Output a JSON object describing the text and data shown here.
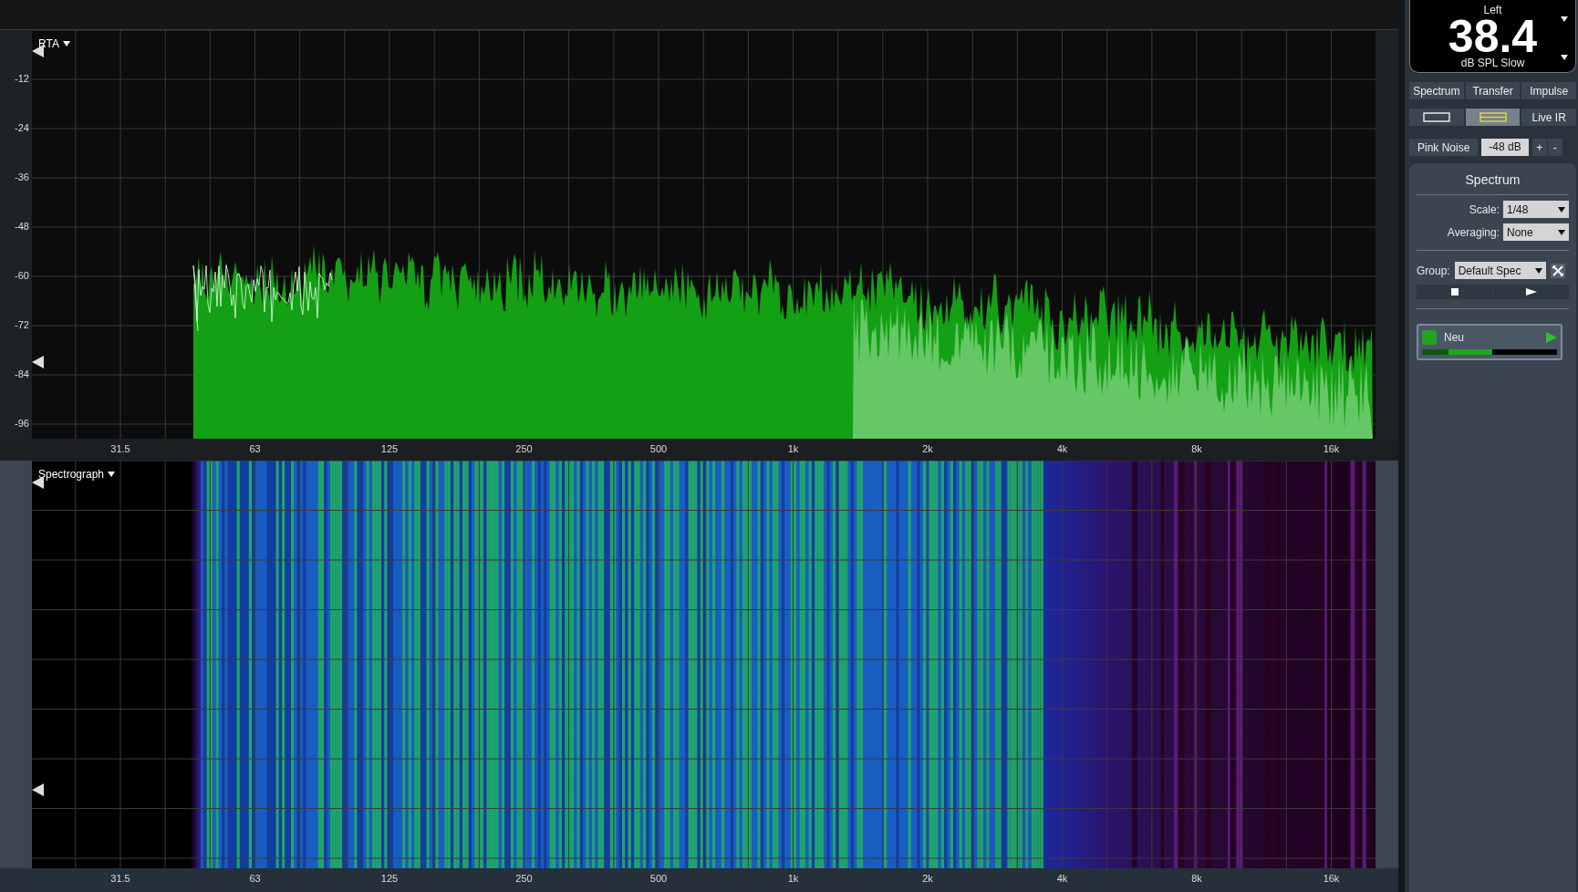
{
  "rta": {
    "title": "RTA",
    "y_labels": [
      "-12",
      "-24",
      "-36",
      "-48",
      "-60",
      "-72",
      "-84",
      "-96"
    ],
    "x_labels": [
      "31.5",
      "63",
      "125",
      "250",
      "500",
      "1k",
      "2k",
      "4k",
      "8k",
      "16k"
    ]
  },
  "spectrograph": {
    "title": "Spectrograph",
    "x_labels": [
      "31.5",
      "63",
      "125",
      "250",
      "500",
      "1k",
      "2k",
      "4k",
      "8k",
      "16k"
    ]
  },
  "meter": {
    "channel": "Left",
    "value": "38.4",
    "unit": "dB SPL Slow"
  },
  "tabs": [
    {
      "label": "Spectrum",
      "selected": false
    },
    {
      "label": "Transfer",
      "selected": false
    },
    {
      "label": "Impulse",
      "selected": false
    }
  ],
  "view_buttons": [
    {
      "kind": "single",
      "selected": false
    },
    {
      "kind": "split",
      "selected": true
    },
    {
      "kind": "text",
      "label": "Live IR",
      "selected": false
    }
  ],
  "generator": {
    "label": "Pink Noise",
    "gain": "-48 dB",
    "buttons": [
      "+",
      "-"
    ]
  },
  "settings": {
    "title": "Spectrum",
    "fields": [
      {
        "label": "Scale:",
        "value": "1/48"
      },
      {
        "label": "Averaging:",
        "value": "None"
      }
    ],
    "group": {
      "label": "Group:",
      "value": "Default Spec"
    }
  },
  "traces": [
    {
      "name": "Neu",
      "color": "#22a322",
      "level": 0.52
    }
  ]
}
